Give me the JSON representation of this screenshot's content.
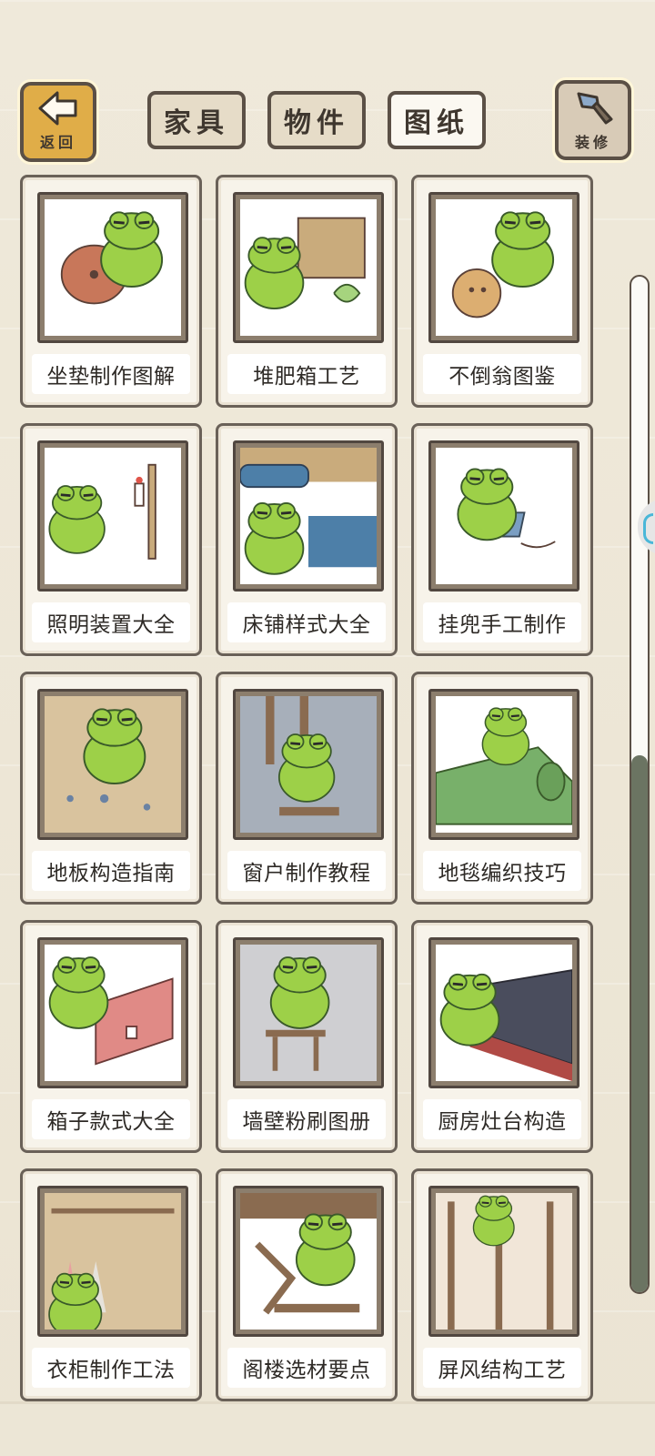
{
  "header": {
    "back_label": "返回",
    "decorate_label": "装修",
    "tabs": [
      {
        "label": "家具",
        "active": false
      },
      {
        "label": "物件",
        "active": false
      },
      {
        "label": "图纸",
        "active": true
      }
    ]
  },
  "items": [
    {
      "label": "坐垫制作图解",
      "icon": "frog-cushion"
    },
    {
      "label": "堆肥箱工艺",
      "icon": "frog-compost-box"
    },
    {
      "label": "不倒翁图鉴",
      "icon": "frog-tumbler"
    },
    {
      "label": "照明装置大全",
      "icon": "frog-candle-lamp"
    },
    {
      "label": "床铺样式大全",
      "icon": "frog-bed"
    },
    {
      "label": "挂兜手工制作",
      "icon": "frog-sewing-bag"
    },
    {
      "label": "地板构造指南",
      "icon": "frog-floor"
    },
    {
      "label": "窗户制作教程",
      "icon": "frog-window"
    },
    {
      "label": "地毯编织技巧",
      "icon": "frog-carpet"
    },
    {
      "label": "箱子款式大全",
      "icon": "frog-chest"
    },
    {
      "label": "墙壁粉刷图册",
      "icon": "frog-wall-painting"
    },
    {
      "label": "厨房灶台构造",
      "icon": "frog-kitchen-stove"
    },
    {
      "label": "衣柜制作工法",
      "icon": "frog-wardrobe"
    },
    {
      "label": "阁楼选材要点",
      "icon": "frog-loft"
    },
    {
      "label": "屏风结构工艺",
      "icon": "frog-folding-screen"
    }
  ],
  "colors": {
    "frog_green": "#9dd048",
    "back_button": "#e0ad48",
    "scrollbar_thumb": "#6b7462"
  }
}
